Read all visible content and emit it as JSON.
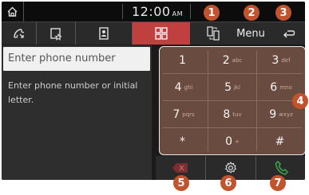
{
  "statusbar": {
    "time": "12:00",
    "ampm": "AM"
  },
  "tabs": {
    "menu_label": "Menu"
  },
  "input": {
    "placeholder": "Enter phone number"
  },
  "hint": "Enter phone number or initial letter.",
  "keypad": {
    "keys": [
      {
        "main": "1",
        "sub": ""
      },
      {
        "main": "2",
        "sub": "abc"
      },
      {
        "main": "3",
        "sub": "def"
      },
      {
        "main": "4",
        "sub": "ghi"
      },
      {
        "main": "5",
        "sub": "jkl"
      },
      {
        "main": "6",
        "sub": "mno"
      },
      {
        "main": "7",
        "sub": "pqrs"
      },
      {
        "main": "8",
        "sub": "tuv"
      },
      {
        "main": "9",
        "sub": "wxyz"
      },
      {
        "main": "*",
        "sub": ""
      },
      {
        "main": "0",
        "sub": "+"
      },
      {
        "main": "#",
        "sub": ""
      }
    ]
  },
  "callouts": [
    "1",
    "2",
    "3",
    "4",
    "5",
    "6",
    "7"
  ],
  "colors": {
    "accent": "#c04040",
    "callout": "#c2542d",
    "keypad": "#6a4b40",
    "call_green": "#3aa04a"
  },
  "icons": {
    "home": "home-icon",
    "recent_calls": "recent-calls-icon",
    "favorites": "favorites-icon",
    "contacts": "contacts-icon",
    "dial_pad": "dial-pad-icon",
    "switch_phone": "switch-device-icon",
    "back": "back-icon",
    "delete": "backspace-icon",
    "settings": "settings-icon",
    "call": "call-icon"
  }
}
